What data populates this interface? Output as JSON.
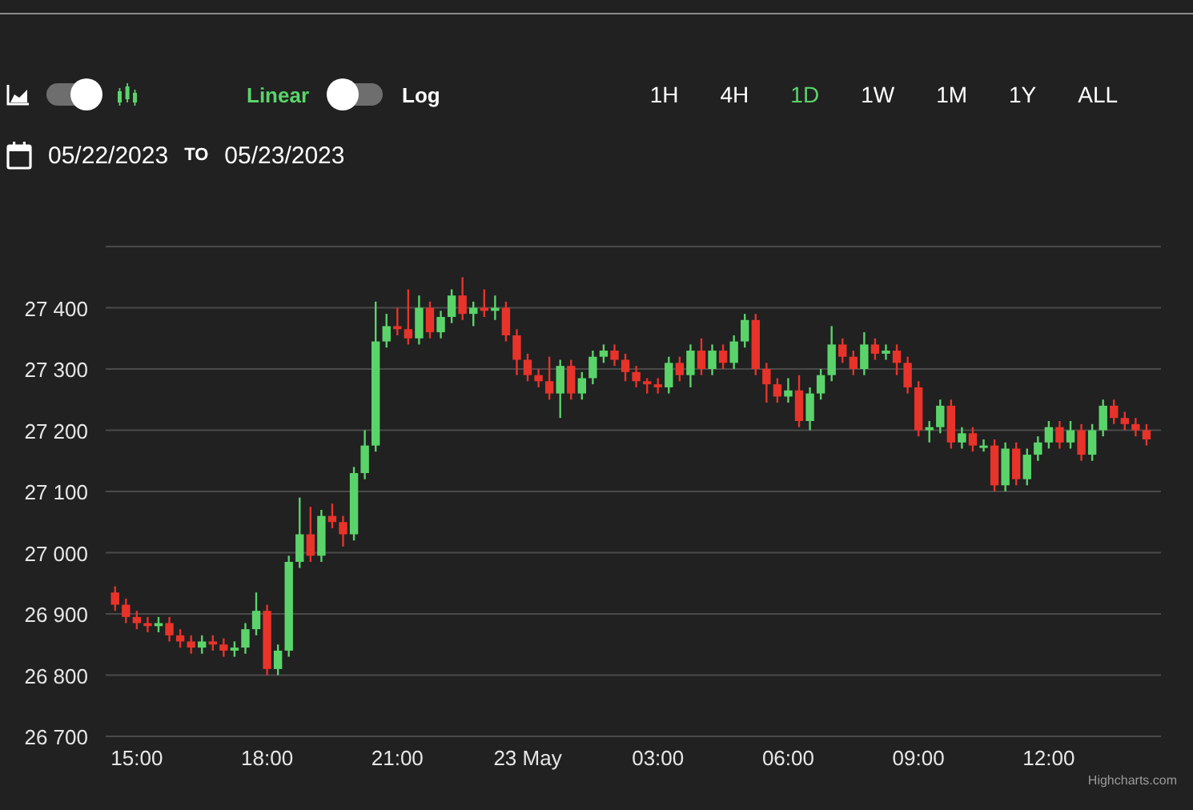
{
  "toolbar": {
    "chart_type_toggle": {
      "on": true
    },
    "scale": [
      {
        "label": "Linear",
        "selected": true
      },
      {
        "label": "Log",
        "selected": false
      }
    ],
    "ranges": [
      {
        "label": "1H",
        "selected": false
      },
      {
        "label": "4H",
        "selected": false
      },
      {
        "label": "1D",
        "selected": true
      },
      {
        "label": "1W",
        "selected": false
      },
      {
        "label": "1M",
        "selected": false
      },
      {
        "label": "1Y",
        "selected": false
      },
      {
        "label": "ALL",
        "selected": false
      }
    ]
  },
  "date_range": {
    "from": "05/22/2023",
    "separator": "TO",
    "to": "05/23/2023"
  },
  "chart": {
    "credit": "Highcharts.com",
    "chart_data": {
      "type": "candlestick",
      "grid": true,
      "x": [
        "2023-05-22T14:30",
        "2023-05-22T14:45",
        "2023-05-22T15:00",
        "2023-05-22T15:15",
        "2023-05-22T15:30",
        "2023-05-22T15:45",
        "2023-05-22T16:00",
        "2023-05-22T16:15",
        "2023-05-22T16:30",
        "2023-05-22T16:45",
        "2023-05-22T17:00",
        "2023-05-22T17:15",
        "2023-05-22T17:30",
        "2023-05-22T17:45",
        "2023-05-22T18:00",
        "2023-05-22T18:15",
        "2023-05-22T18:30",
        "2023-05-22T18:45",
        "2023-05-22T19:00",
        "2023-05-22T19:15",
        "2023-05-22T19:30",
        "2023-05-22T19:45",
        "2023-05-22T20:00",
        "2023-05-22T20:15",
        "2023-05-22T20:30",
        "2023-05-22T20:45",
        "2023-05-22T21:00",
        "2023-05-22T21:15",
        "2023-05-22T21:30",
        "2023-05-22T21:45",
        "2023-05-22T22:00",
        "2023-05-22T22:15",
        "2023-05-22T22:30",
        "2023-05-22T22:45",
        "2023-05-22T23:00",
        "2023-05-22T23:15",
        "2023-05-22T23:30",
        "2023-05-22T23:45",
        "2023-05-23T00:00",
        "2023-05-23T00:15",
        "2023-05-23T00:30",
        "2023-05-23T00:45",
        "2023-05-23T01:00",
        "2023-05-23T01:15",
        "2023-05-23T01:30",
        "2023-05-23T01:45",
        "2023-05-23T02:00",
        "2023-05-23T02:15",
        "2023-05-23T02:30",
        "2023-05-23T02:45",
        "2023-05-23T03:00",
        "2023-05-23T03:15",
        "2023-05-23T03:30",
        "2023-05-23T03:45",
        "2023-05-23T04:00",
        "2023-05-23T04:15",
        "2023-05-23T04:30",
        "2023-05-23T04:45",
        "2023-05-23T05:00",
        "2023-05-23T05:15",
        "2023-05-23T05:30",
        "2023-05-23T05:45",
        "2023-05-23T06:00",
        "2023-05-23T06:15",
        "2023-05-23T06:30",
        "2023-05-23T06:45",
        "2023-05-23T07:00",
        "2023-05-23T07:15",
        "2023-05-23T07:30",
        "2023-05-23T07:45",
        "2023-05-23T08:00",
        "2023-05-23T08:15",
        "2023-05-23T08:30",
        "2023-05-23T08:45",
        "2023-05-23T09:00",
        "2023-05-23T09:15",
        "2023-05-23T09:30",
        "2023-05-23T09:45",
        "2023-05-23T10:00",
        "2023-05-23T10:15",
        "2023-05-23T10:30",
        "2023-05-23T10:45",
        "2023-05-23T11:00",
        "2023-05-23T11:15",
        "2023-05-23T11:30",
        "2023-05-23T11:45",
        "2023-05-23T12:00",
        "2023-05-23T12:15",
        "2023-05-23T12:30",
        "2023-05-23T12:45",
        "2023-05-23T13:00",
        "2023-05-23T13:15",
        "2023-05-23T13:30",
        "2023-05-23T13:45",
        "2023-05-23T14:00",
        "2023-05-23T14:15"
      ],
      "ohlc": [
        [
          26935,
          26945,
          26905,
          26915
        ],
        [
          26915,
          26925,
          26885,
          26895
        ],
        [
          26895,
          26905,
          26875,
          26885
        ],
        [
          26885,
          26895,
          26870,
          26880
        ],
        [
          26880,
          26895,
          26870,
          26885
        ],
        [
          26885,
          26895,
          26855,
          26865
        ],
        [
          26865,
          26875,
          26845,
          26855
        ],
        [
          26855,
          26865,
          26835,
          26845
        ],
        [
          26845,
          26865,
          26835,
          26855
        ],
        [
          26855,
          26865,
          26840,
          26850
        ],
        [
          26850,
          26860,
          26830,
          26840
        ],
        [
          26840,
          26855,
          26830,
          26845
        ],
        [
          26845,
          26885,
          26835,
          26875
        ],
        [
          26875,
          26935,
          26865,
          26905
        ],
        [
          26905,
          26915,
          26800,
          26810
        ],
        [
          26810,
          26850,
          26800,
          26840
        ],
        [
          26840,
          26995,
          26830,
          26985
        ],
        [
          26985,
          27090,
          26975,
          27030
        ],
        [
          27030,
          27075,
          26985,
          26995
        ],
        [
          26995,
          27070,
          26985,
          27060
        ],
        [
          27060,
          27080,
          27040,
          27050
        ],
        [
          27050,
          27060,
          27010,
          27030
        ],
        [
          27030,
          27140,
          27020,
          27130
        ],
        [
          27130,
          27200,
          27120,
          27175
        ],
        [
          27175,
          27410,
          27165,
          27345
        ],
        [
          27345,
          27390,
          27335,
          27370
        ],
        [
          27370,
          27400,
          27355,
          27365
        ],
        [
          27365,
          27430,
          27340,
          27350
        ],
        [
          27350,
          27420,
          27340,
          27400
        ],
        [
          27400,
          27410,
          27350,
          27360
        ],
        [
          27360,
          27395,
          27350,
          27385
        ],
        [
          27385,
          27430,
          27375,
          27420
        ],
        [
          27420,
          27450,
          27380,
          27390
        ],
        [
          27390,
          27410,
          27370,
          27400
        ],
        [
          27400,
          27430,
          27385,
          27395
        ],
        [
          27395,
          27420,
          27380,
          27400
        ],
        [
          27400,
          27410,
          27345,
          27355
        ],
        [
          27355,
          27365,
          27290,
          27315
        ],
        [
          27315,
          27325,
          27280,
          27290
        ],
        [
          27290,
          27300,
          27270,
          27280
        ],
        [
          27280,
          27320,
          27250,
          27260
        ],
        [
          27260,
          27315,
          27220,
          27305
        ],
        [
          27305,
          27315,
          27250,
          27260
        ],
        [
          27260,
          27295,
          27250,
          27285
        ],
        [
          27285,
          27330,
          27275,
          27320
        ],
        [
          27320,
          27340,
          27310,
          27330
        ],
        [
          27330,
          27340,
          27305,
          27315
        ],
        [
          27315,
          27325,
          27280,
          27295
        ],
        [
          27295,
          27305,
          27270,
          27280
        ],
        [
          27280,
          27285,
          27260,
          27275
        ],
        [
          27275,
          27285,
          27260,
          27270
        ],
        [
          27270,
          27320,
          27260,
          27310
        ],
        [
          27310,
          27320,
          27280,
          27290
        ],
        [
          27290,
          27340,
          27270,
          27330
        ],
        [
          27330,
          27350,
          27290,
          27300
        ],
        [
          27300,
          27340,
          27290,
          27330
        ],
        [
          27330,
          27340,
          27300,
          27310
        ],
        [
          27310,
          27355,
          27300,
          27345
        ],
        [
          27345,
          27390,
          27335,
          27380
        ],
        [
          27380,
          27390,
          27290,
          27300
        ],
        [
          27300,
          27310,
          27245,
          27275
        ],
        [
          27275,
          27285,
          27245,
          27255
        ],
        [
          27255,
          27285,
          27245,
          27265
        ],
        [
          27265,
          27290,
          27205,
          27215
        ],
        [
          27215,
          27270,
          27200,
          27260
        ],
        [
          27260,
          27300,
          27250,
          27290
        ],
        [
          27290,
          27370,
          27280,
          27340
        ],
        [
          27340,
          27350,
          27310,
          27320
        ],
        [
          27320,
          27330,
          27290,
          27300
        ],
        [
          27300,
          27360,
          27290,
          27340
        ],
        [
          27340,
          27350,
          27315,
          27325
        ],
        [
          27325,
          27340,
          27315,
          27330
        ],
        [
          27330,
          27340,
          27290,
          27310
        ],
        [
          27310,
          27320,
          27260,
          27270
        ],
        [
          27270,
          27280,
          27190,
          27200
        ],
        [
          27200,
          27215,
          27180,
          27205
        ],
        [
          27205,
          27250,
          27195,
          27240
        ],
        [
          27240,
          27250,
          27170,
          27180
        ],
        [
          27180,
          27205,
          27170,
          27195
        ],
        [
          27195,
          27205,
          27165,
          27175
        ],
        [
          27175,
          27185,
          27165,
          27175
        ],
        [
          27175,
          27185,
          27100,
          27110
        ],
        [
          27110,
          27180,
          27100,
          27170
        ],
        [
          27170,
          27180,
          27110,
          27120
        ],
        [
          27120,
          27170,
          27110,
          27160
        ],
        [
          27160,
          27190,
          27150,
          27180
        ],
        [
          27180,
          27215,
          27170,
          27205
        ],
        [
          27205,
          27215,
          27170,
          27180
        ],
        [
          27180,
          27215,
          27170,
          27200
        ],
        [
          27200,
          27210,
          27150,
          27160
        ],
        [
          27160,
          27210,
          27150,
          27200
        ],
        [
          27200,
          27250,
          27190,
          27240
        ],
        [
          27240,
          27250,
          27210,
          27220
        ],
        [
          27220,
          27230,
          27200,
          27210
        ],
        [
          27210,
          27220,
          27190,
          27200
        ],
        [
          27200,
          27210,
          27175,
          27185
        ]
      ],
      "xlim": [
        "2023-05-22T14:17",
        "2023-05-23T14:35"
      ],
      "ylim": [
        26700,
        27500
      ],
      "xticks": [
        {
          "value": "2023-05-22T15:00",
          "label": "15:00"
        },
        {
          "value": "2023-05-22T18:00",
          "label": "18:00"
        },
        {
          "value": "2023-05-22T21:00",
          "label": "21:00"
        },
        {
          "value": "2023-05-23T00:00",
          "label": "23 May"
        },
        {
          "value": "2023-05-23T03:00",
          "label": "03:00"
        },
        {
          "value": "2023-05-23T06:00",
          "label": "06:00"
        },
        {
          "value": "2023-05-23T09:00",
          "label": "09:00"
        },
        {
          "value": "2023-05-23T12:00",
          "label": "12:00"
        }
      ],
      "yticks": [
        {
          "value": 26700,
          "label": "26 700"
        },
        {
          "value": 26800,
          "label": "26 800"
        },
        {
          "value": 26900,
          "label": "26 900"
        },
        {
          "value": 27000,
          "label": "27 000"
        },
        {
          "value": 27100,
          "label": "27 100"
        },
        {
          "value": 27200,
          "label": "27 200"
        },
        {
          "value": 27300,
          "label": "27 300"
        },
        {
          "value": 27400,
          "label": "27 400"
        }
      ]
    }
  }
}
